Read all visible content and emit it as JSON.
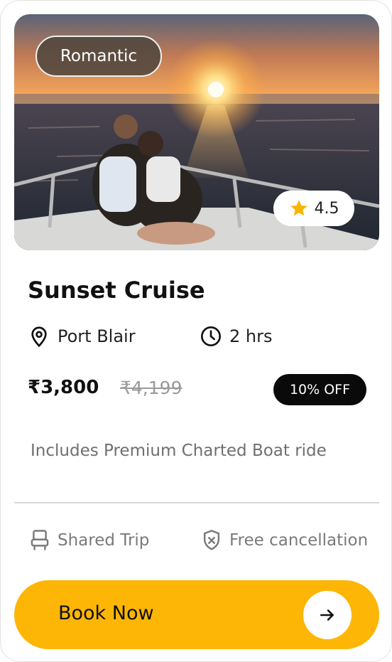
{
  "card": {
    "tag": "Romantic",
    "rating": "4.5",
    "title": "Sunset Cruise",
    "location": "Port Blair",
    "duration": "2 hrs",
    "price": "₹3,800",
    "old_price": "₹4,199",
    "discount": "10% OFF",
    "includes": "Includes Premium Charted Boat ride",
    "features": {
      "shared": "Shared Trip",
      "cancellation": "Free cancellation"
    },
    "cta": "Book Now"
  },
  "icons": {
    "rating": "star-icon",
    "location": "location-pin-icon",
    "duration": "clock-icon",
    "shared": "seat-icon",
    "cancellation": "shield-x-icon",
    "cta": "arrow-right-icon"
  },
  "colors": {
    "accent": "#fdb606",
    "star": "#f7b500",
    "badge_bg": "#0a0a0a",
    "tag_bg": "#4e463e"
  }
}
